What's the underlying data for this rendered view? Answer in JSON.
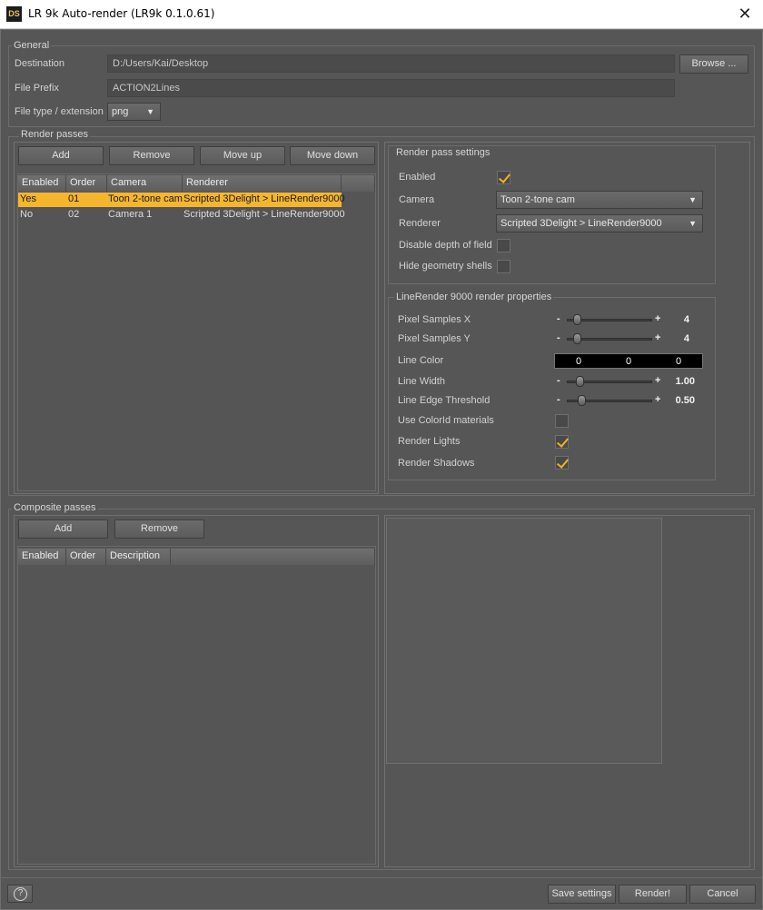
{
  "window": {
    "icon_text": "DS",
    "title": "LR 9k Auto-render (LR9k 0.1.0.61)",
    "close_glyph": "✕"
  },
  "general": {
    "group_label": "General",
    "destination_label": "Destination",
    "destination_value": "D:/Users/Kai/Desktop",
    "browse_label": "Browse ...",
    "prefix_label": "File Prefix",
    "prefix_value": "ACTION2Lines",
    "type_label": "File type / extension",
    "type_value": "png"
  },
  "render_passes": {
    "group_label": "Render passes",
    "buttons": {
      "add": "Add",
      "remove": "Remove",
      "move_up": "Move up",
      "move_down": "Move down"
    },
    "columns": [
      "Enabled",
      "Order",
      "Camera",
      "Renderer"
    ],
    "rows": [
      {
        "enabled": "Yes",
        "order": "01",
        "camera": "Toon 2-tone cam",
        "renderer": "Scripted 3Delight > LineRender9000",
        "selected": true
      },
      {
        "enabled": "No",
        "order": "02",
        "camera": "Camera 1",
        "renderer": "Scripted 3Delight > LineRender9000",
        "selected": false
      }
    ]
  },
  "pass_settings": {
    "group_label": "Render pass settings",
    "enabled_label": "Enabled",
    "enabled": true,
    "camera_label": "Camera",
    "camera_value": "Toon 2-tone cam",
    "renderer_label": "Renderer",
    "renderer_value": "Scripted 3Delight > LineRender9000",
    "dof_label": "Disable depth of field",
    "dof": false,
    "shells_label": "Hide geometry shells",
    "shells": false
  },
  "lr_props": {
    "group_label": "LineRender 9000 render properties",
    "pixel_x_label": "Pixel Samples X",
    "pixel_x_value": "4",
    "pixel_y_label": "Pixel Samples Y",
    "pixel_y_value": "4",
    "line_color_label": "Line Color",
    "line_color": [
      "0",
      "0",
      "0"
    ],
    "line_width_label": "Line Width",
    "line_width_value": "1.00",
    "edge_label": "Line Edge Threshold",
    "edge_value": "0.50",
    "colorid_label": "Use ColorId materials",
    "colorid": false,
    "lights_label": "Render Lights",
    "lights": true,
    "shadows_label": "Render Shadows",
    "shadows": true
  },
  "composite": {
    "group_label": "Composite passes",
    "buttons": {
      "add": "Add",
      "remove": "Remove"
    },
    "columns": [
      "Enabled",
      "Order",
      "Description"
    ]
  },
  "footer": {
    "help_glyph": "?",
    "save_label": "Save settings",
    "render_label": "Render!",
    "cancel_label": "Cancel"
  },
  "colors": {
    "accent": "#f5b62e",
    "background": "#565656"
  }
}
